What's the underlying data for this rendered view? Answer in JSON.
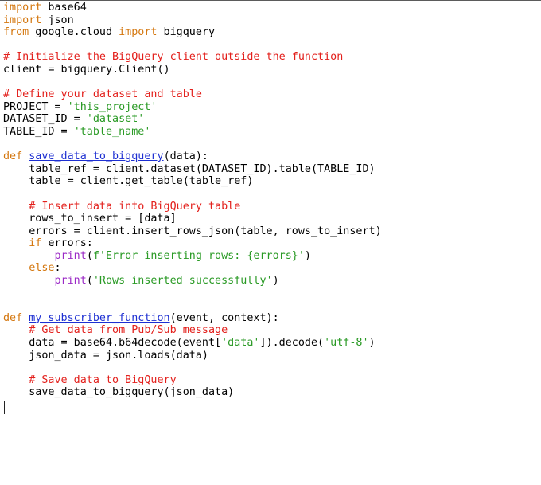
{
  "editor": {
    "colors": {
      "keyword": "#d4770f",
      "comment": "#e3201c",
      "string": "#2a9a25",
      "function_name": "#1d2fd2",
      "builtin": "#9b2ac6",
      "text": "#000000",
      "background": "#ffffff"
    },
    "lines": [
      [
        {
          "t": "kw",
          "v": "import"
        },
        {
          "t": "tx",
          "v": " base64"
        }
      ],
      [
        {
          "t": "kw",
          "v": "import"
        },
        {
          "t": "tx",
          "v": " json"
        }
      ],
      [
        {
          "t": "kw",
          "v": "from"
        },
        {
          "t": "tx",
          "v": " google.cloud "
        },
        {
          "t": "kw",
          "v": "import"
        },
        {
          "t": "tx",
          "v": " bigquery"
        }
      ],
      [],
      [
        {
          "t": "cm",
          "v": "# Initialize the BigQuery client outside the function"
        }
      ],
      [
        {
          "t": "tx",
          "v": "client = bigquery.Client()"
        }
      ],
      [],
      [
        {
          "t": "cm",
          "v": "# Define your dataset and table"
        }
      ],
      [
        {
          "t": "tx",
          "v": "PROJECT = "
        },
        {
          "t": "st",
          "v": "'this_project'"
        }
      ],
      [
        {
          "t": "tx",
          "v": "DATASET_ID = "
        },
        {
          "t": "st",
          "v": "'dataset'"
        }
      ],
      [
        {
          "t": "tx",
          "v": "TABLE_ID = "
        },
        {
          "t": "st",
          "v": "'table_name'"
        }
      ],
      [],
      [
        {
          "t": "kw",
          "v": "def"
        },
        {
          "t": "tx",
          "v": " "
        },
        {
          "t": "fn",
          "v": "save_data_to_bigquery"
        },
        {
          "t": "tx",
          "v": "(data):"
        }
      ],
      [
        {
          "t": "tx",
          "v": "    table_ref = client.dataset(DATASET_ID).table(TABLE_ID)"
        }
      ],
      [
        {
          "t": "tx",
          "v": "    table = client.get_table(table_ref)"
        }
      ],
      [],
      [
        {
          "t": "tx",
          "v": "    "
        },
        {
          "t": "cm",
          "v": "# Insert data into BigQuery table"
        }
      ],
      [
        {
          "t": "tx",
          "v": "    rows_to_insert = [data]"
        }
      ],
      [
        {
          "t": "tx",
          "v": "    errors = client.insert_rows_json(table, rows_to_insert)"
        }
      ],
      [
        {
          "t": "tx",
          "v": "    "
        },
        {
          "t": "kw",
          "v": "if"
        },
        {
          "t": "tx",
          "v": " errors:"
        }
      ],
      [
        {
          "t": "tx",
          "v": "        "
        },
        {
          "t": "bi",
          "v": "print"
        },
        {
          "t": "tx",
          "v": "("
        },
        {
          "t": "st",
          "v": "f'Error inserting rows: {errors}'"
        },
        {
          "t": "tx",
          "v": ")"
        }
      ],
      [
        {
          "t": "tx",
          "v": "    "
        },
        {
          "t": "kw",
          "v": "else"
        },
        {
          "t": "tx",
          "v": ":"
        }
      ],
      [
        {
          "t": "tx",
          "v": "        "
        },
        {
          "t": "bi",
          "v": "print"
        },
        {
          "t": "tx",
          "v": "("
        },
        {
          "t": "st",
          "v": "'Rows inserted successfully'"
        },
        {
          "t": "tx",
          "v": ")"
        }
      ],
      [],
      [],
      [
        {
          "t": "kw",
          "v": "def"
        },
        {
          "t": "tx",
          "v": " "
        },
        {
          "t": "fn",
          "v": "my_subscriber_function"
        },
        {
          "t": "tx",
          "v": "(event, context):"
        }
      ],
      [
        {
          "t": "tx",
          "v": "    "
        },
        {
          "t": "cm",
          "v": "# Get data from Pub/Sub message"
        }
      ],
      [
        {
          "t": "tx",
          "v": "    data = base64.b64decode(event["
        },
        {
          "t": "st",
          "v": "'data'"
        },
        {
          "t": "tx",
          "v": "]).decode("
        },
        {
          "t": "st",
          "v": "'utf-8'"
        },
        {
          "t": "tx",
          "v": ")"
        }
      ],
      [
        {
          "t": "tx",
          "v": "    json_data = json.loads(data)"
        }
      ],
      [],
      [
        {
          "t": "tx",
          "v": "    "
        },
        {
          "t": "cm",
          "v": "# Save data to BigQuery"
        }
      ],
      [
        {
          "t": "tx",
          "v": "    save_data_to_bigquery(json_data)"
        }
      ]
    ]
  }
}
